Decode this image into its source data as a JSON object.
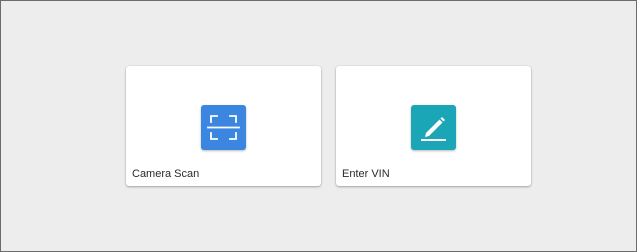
{
  "options": [
    {
      "label": "Camera Scan",
      "icon": "scan-frame-icon",
      "color": "#3a86e0"
    },
    {
      "label": "Enter VIN",
      "icon": "pencil-edit-icon",
      "color": "#1aa6b6"
    }
  ]
}
